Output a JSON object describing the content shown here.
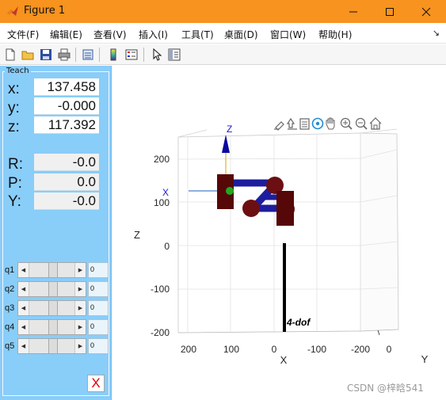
{
  "window": {
    "title": "Figure 1",
    "controls": {
      "minimize": "—",
      "maximize": "☐",
      "close": "✕"
    }
  },
  "menu": {
    "items": [
      "文件(F)",
      "编辑(E)",
      "查看(V)",
      "插入(I)",
      "工具(T)",
      "桌面(D)",
      "窗口(W)",
      "帮助(H)"
    ],
    "overflow": "↘"
  },
  "toolbar": {
    "icons": [
      "new-figure-icon",
      "open-icon",
      "save-icon",
      "print-icon",
      "link-plot-icon",
      "colorbar-icon",
      "legend-icon",
      "pointer-icon",
      "property-inspector-icon"
    ]
  },
  "teach_panel": {
    "title": "Teach",
    "position": {
      "x_label": "x:",
      "x_value": "137.458",
      "y_label": "y:",
      "y_value": "-0.000",
      "z_label": "z:",
      "z_value": "117.392"
    },
    "orientation": {
      "r_label": "R:",
      "r_value": "-0.0",
      "p_label": "P:",
      "p_value": "0.0",
      "yaw_label": "Y:",
      "yaw_value": "-0.0"
    },
    "joints": [
      {
        "label": "q1",
        "value": "0"
      },
      {
        "label": "q2",
        "value": "0"
      },
      {
        "label": "q3",
        "value": "0"
      },
      {
        "label": "q4",
        "value": "0"
      },
      {
        "label": "q5",
        "value": "0"
      }
    ],
    "close_label": "X"
  },
  "axes_toolbar": {
    "icons": [
      "brush-icon",
      "data-tips-icon",
      "export-icon",
      "rotate-3d-icon",
      "pan-icon",
      "zoom-in-icon",
      "zoom-out-icon",
      "home-icon"
    ]
  },
  "plot": {
    "z_axis_label": "Z",
    "x_axis_label": "X",
    "y_axis_label": "Y",
    "z_ticks": [
      "200",
      "100",
      "0",
      "-100",
      "-200"
    ],
    "x_ticks": [
      "200",
      "100",
      "0",
      "-100",
      "-200"
    ],
    "y_ticks": [
      "0"
    ],
    "frame_x_label": "X",
    "frame_z_label": "Z",
    "robot_name": "4-dof",
    "colors": {
      "link": "#1a1a9e",
      "joint": "#5a0808",
      "joint_round": "#6b0f12",
      "frame_axis": "#2222cc",
      "end_effector": "#1faa1f",
      "base": "#000000"
    }
  },
  "watermark": "CSDN @梓晗541"
}
